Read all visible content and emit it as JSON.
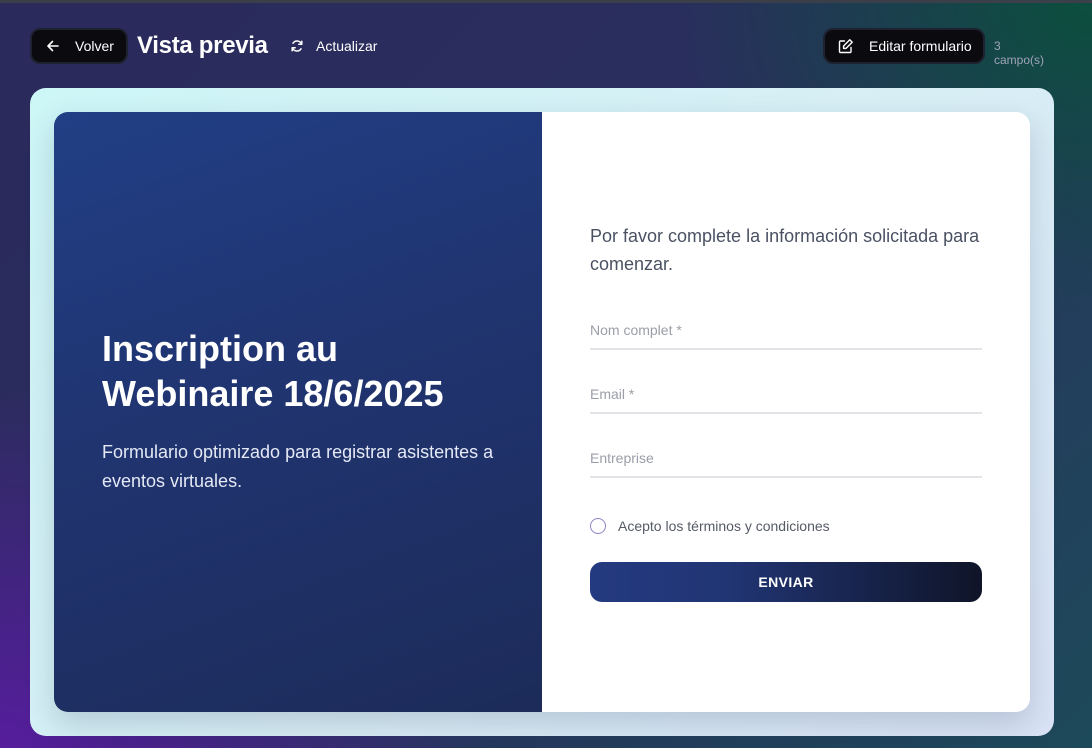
{
  "header": {
    "back_label": "Volver",
    "title": "Vista previa",
    "refresh_label": "Actualizar",
    "edit_label": "Editar formulario",
    "fields_count": "3 campo(s)"
  },
  "hero": {
    "title": "Inscription au Webinaire 18/6/2025",
    "subtitle": "Formulario optimizado para registrar asistentes a eventos virtuales."
  },
  "form": {
    "intro": "Por favor complete la información solicitada para comenzar.",
    "fields": [
      {
        "placeholder": "Nom complet *",
        "value": ""
      },
      {
        "placeholder": "Email *",
        "value": ""
      },
      {
        "placeholder": "Entreprise",
        "value": ""
      }
    ],
    "terms_label": "Acepto los términos y condiciones",
    "terms_checked": false,
    "submit_label": "ENVIAR"
  },
  "icons": {
    "back": "arrow-left-icon",
    "refresh": "refresh-icon",
    "edit": "edit-icon"
  },
  "colors": {
    "hero_bg": "#213f85",
    "button_dark": "#0b0b0f",
    "submit_start": "#243a80",
    "submit_end": "#0f1428"
  }
}
